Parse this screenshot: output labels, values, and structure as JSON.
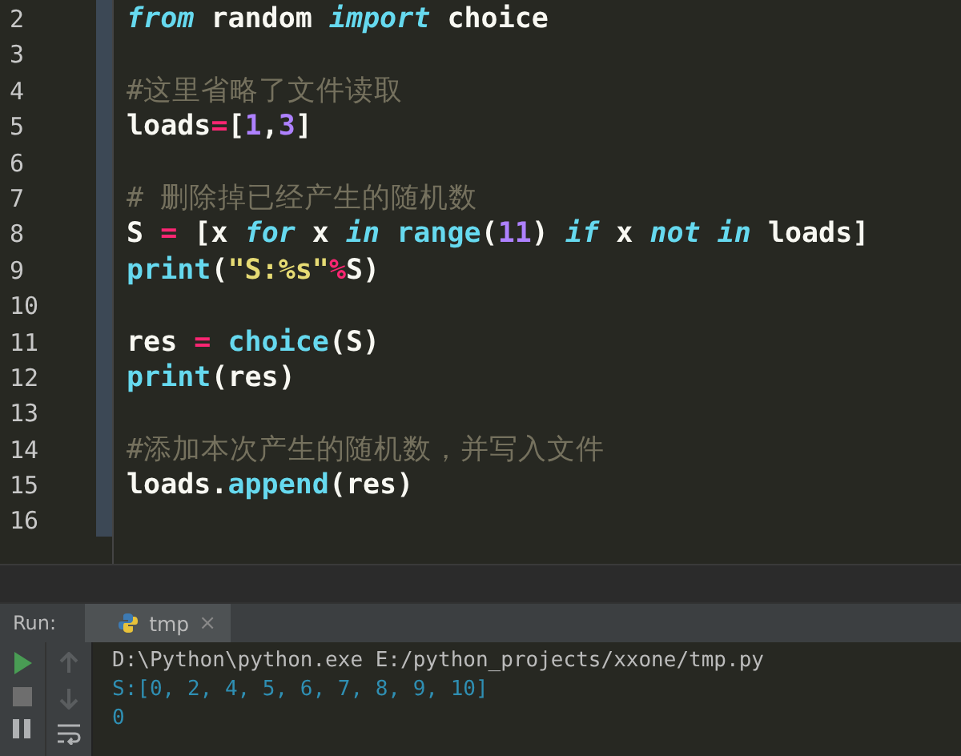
{
  "editor": {
    "lines": [
      {
        "number": "2",
        "tokens": [
          {
            "text": "from",
            "kind": "keyword"
          },
          {
            "text": " random ",
            "kind": "plain"
          },
          {
            "text": "import",
            "kind": "keyword"
          },
          {
            "text": " choice",
            "kind": "plain"
          }
        ]
      },
      {
        "number": "3"
      },
      {
        "number": "4",
        "tokens": [
          {
            "text": "#这里省略了文件读取",
            "kind": "comment"
          }
        ]
      },
      {
        "number": "5",
        "tokens": [
          {
            "text": "loads",
            "kind": "plain"
          },
          {
            "text": "=",
            "kind": "operator"
          },
          {
            "text": "[",
            "kind": "plain"
          },
          {
            "text": "1",
            "kind": "number"
          },
          {
            "text": ",",
            "kind": "plain"
          },
          {
            "text": "3",
            "kind": "number"
          },
          {
            "text": "]",
            "kind": "plain"
          }
        ]
      },
      {
        "number": "6"
      },
      {
        "number": "7",
        "tokens": [
          {
            "text": "# 删除掉已经产生的随机数",
            "kind": "comment"
          }
        ]
      },
      {
        "number": "8",
        "tokens": [
          {
            "text": "S ",
            "kind": "plain"
          },
          {
            "text": "=",
            "kind": "operator"
          },
          {
            "text": " [x ",
            "kind": "plain"
          },
          {
            "text": "for",
            "kind": "keyword"
          },
          {
            "text": " x ",
            "kind": "plain"
          },
          {
            "text": "in",
            "kind": "keyword"
          },
          {
            "text": " range",
            "kind": "builtin"
          },
          {
            "text": "(",
            "kind": "plain"
          },
          {
            "text": "11",
            "kind": "number"
          },
          {
            "text": ") ",
            "kind": "plain"
          },
          {
            "text": "if",
            "kind": "keyword"
          },
          {
            "text": " x ",
            "kind": "plain"
          },
          {
            "text": "not",
            "kind": "keyword"
          },
          {
            "text": " in",
            "kind": "keyword"
          },
          {
            "text": " loads]",
            "kind": "plain"
          }
        ]
      },
      {
        "number": "9",
        "tokens": [
          {
            "text": "print",
            "kind": "builtin"
          },
          {
            "text": "(",
            "kind": "plain"
          },
          {
            "text": "\"S:%s\"",
            "kind": "string"
          },
          {
            "text": "%",
            "kind": "operator"
          },
          {
            "text": "S)",
            "kind": "plain"
          }
        ]
      },
      {
        "number": "10"
      },
      {
        "number": "11",
        "tokens": [
          {
            "text": "res ",
            "kind": "plain"
          },
          {
            "text": "=",
            "kind": "operator"
          },
          {
            "text": " choice",
            "kind": "builtin"
          },
          {
            "text": "(S)",
            "kind": "plain"
          }
        ]
      },
      {
        "number": "12",
        "tokens": [
          {
            "text": "print",
            "kind": "builtin"
          },
          {
            "text": "(res)",
            "kind": "plain"
          }
        ]
      },
      {
        "number": "13"
      },
      {
        "number": "14",
        "tokens": [
          {
            "text": "#添加本次产生的随机数，并写入文件",
            "kind": "comment"
          }
        ]
      },
      {
        "number": "15",
        "tokens": [
          {
            "text": "loads.",
            "kind": "plain"
          },
          {
            "text": "append",
            "kind": "builtin"
          },
          {
            "text": "(res)",
            "kind": "plain"
          }
        ]
      },
      {
        "number": "16"
      }
    ]
  },
  "run_panel": {
    "label": "Run:",
    "tab": {
      "title": "tmp",
      "close": "×",
      "selected": true
    },
    "console": [
      {
        "text": "D:\\Python\\python.exe E:/python_projects/xxone/tmp.py",
        "kind": "command"
      },
      {
        "text": "S:[0, 2, 4, 5, 6, 7, 8, 9, 10]",
        "kind": "output"
      },
      {
        "text": "0",
        "kind": "output"
      }
    ]
  }
}
